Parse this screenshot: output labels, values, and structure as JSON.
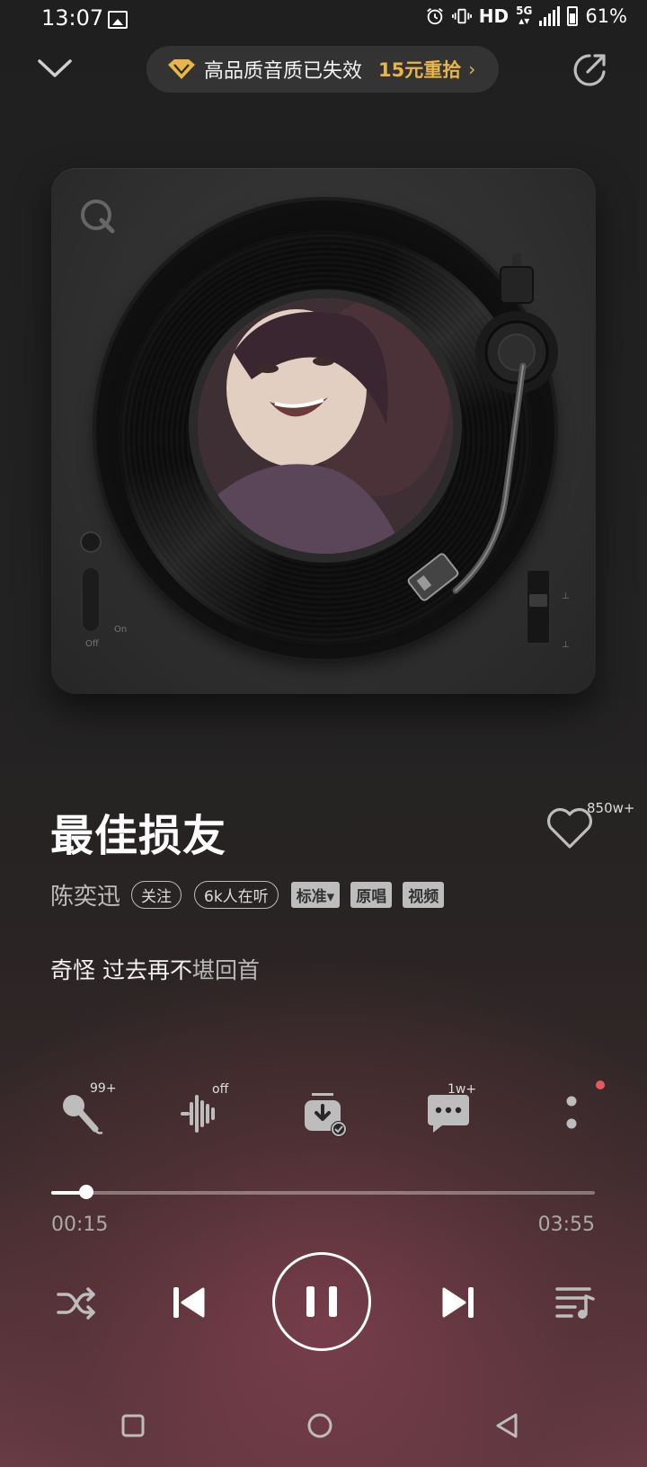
{
  "status_bar": {
    "time": "13:07",
    "network": "HD",
    "network_type": "5G",
    "battery": "61%"
  },
  "header": {
    "quality_text": "高品质音质已失效",
    "quality_offer": "15元重拾",
    "quality_chevron": "›"
  },
  "turntable": {
    "off_label": "Off",
    "on_label": "On"
  },
  "song": {
    "title": "最佳损友",
    "like_count": "850w+",
    "artist": "陈奕迅",
    "follow_label": "关注",
    "listeners": "6k人在听",
    "quality_tag": "标准▾",
    "original_tag": "原唱",
    "video_tag": "视频",
    "lyric_bright": "奇怪 过去再不",
    "lyric_dim": "堪回首"
  },
  "actions": {
    "karaoke_badge": "99+",
    "effects_badge": "off",
    "comments_badge": "1w+"
  },
  "playback": {
    "elapsed": "00:15",
    "total": "03:55",
    "progress_fraction": 0.064
  },
  "colors": {
    "accent_gold": "#e7b54a",
    "notification_dot": "#e65a5a"
  }
}
